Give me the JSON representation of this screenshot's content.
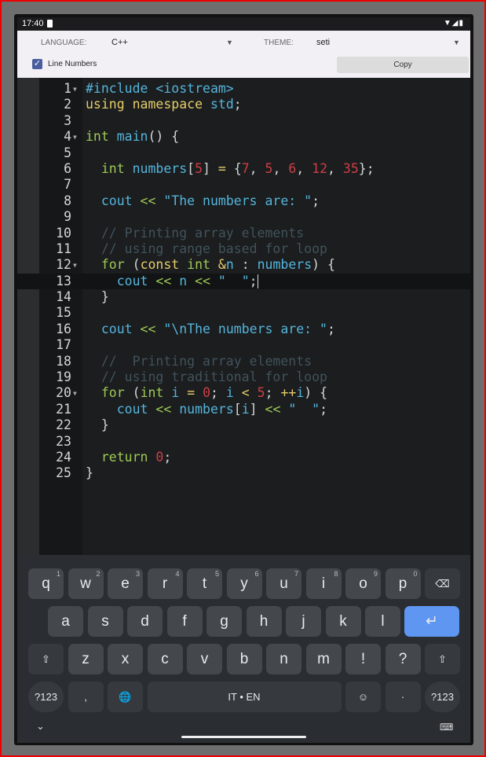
{
  "status": {
    "time": "17:40",
    "icons": "▼◢▮"
  },
  "toolbar": {
    "language_label": "LANGUAGE:",
    "language_value": "C++",
    "theme_label": "THEME:",
    "theme_value": "seti",
    "line_numbers_label": "Line Numbers",
    "line_numbers_checked": true,
    "copy_label": "Copy"
  },
  "colors": {
    "blue": "#55b5db",
    "yellow": "#e6cd69",
    "green": "#9fca56",
    "red": "#cd3f45",
    "comment": "#41535b",
    "enter": "#5e96f2"
  },
  "code": [
    {
      "n": "1",
      "fold": true,
      "t": [
        [
          "blue",
          "#include <iostream>"
        ]
      ]
    },
    {
      "n": "2",
      "t": [
        [
          "yellow",
          "using namespace "
        ],
        [
          "blue",
          "std"
        ],
        [
          "plain",
          ";"
        ]
      ]
    },
    {
      "n": "3",
      "t": []
    },
    {
      "n": "4",
      "fold": true,
      "t": [
        [
          "green",
          "int "
        ],
        [
          "blue",
          "main"
        ],
        [
          "plain",
          "() {"
        ]
      ]
    },
    {
      "n": "5",
      "t": []
    },
    {
      "n": "6",
      "t": [
        [
          "plain",
          "  "
        ],
        [
          "green",
          "int "
        ],
        [
          "blue",
          "numbers"
        ],
        [
          "plain",
          "["
        ],
        [
          "red",
          "5"
        ],
        [
          "plain",
          "] "
        ],
        [
          "yellow",
          "="
        ],
        [
          "plain",
          " {"
        ],
        [
          "red",
          "7"
        ],
        [
          "plain",
          ", "
        ],
        [
          "red",
          "5"
        ],
        [
          "plain",
          ", "
        ],
        [
          "red",
          "6"
        ],
        [
          "plain",
          ", "
        ],
        [
          "red",
          "12"
        ],
        [
          "plain",
          ", "
        ],
        [
          "red",
          "35"
        ],
        [
          "plain",
          "};"
        ]
      ]
    },
    {
      "n": "7",
      "t": []
    },
    {
      "n": "8",
      "t": [
        [
          "plain",
          "  "
        ],
        [
          "blue",
          "cout "
        ],
        [
          "green",
          "<< "
        ],
        [
          "blue",
          "\"The numbers are: \""
        ],
        [
          "plain",
          ";"
        ]
      ]
    },
    {
      "n": "9",
      "t": []
    },
    {
      "n": "10",
      "t": [
        [
          "comment",
          "  // Printing array elements"
        ]
      ]
    },
    {
      "n": "11",
      "t": [
        [
          "comment",
          "  // using range based for loop"
        ]
      ]
    },
    {
      "n": "12",
      "fold": true,
      "t": [
        [
          "plain",
          "  "
        ],
        [
          "green",
          "for "
        ],
        [
          "plain",
          "("
        ],
        [
          "yellow",
          "const "
        ],
        [
          "green",
          "int "
        ],
        [
          "yellow",
          "&"
        ],
        [
          "blue",
          "n "
        ],
        [
          "plain",
          ": "
        ],
        [
          "blue",
          "numbers"
        ],
        [
          "plain",
          ") {"
        ]
      ]
    },
    {
      "n": "13",
      "active": true,
      "cursor": true,
      "t": [
        [
          "plain",
          "    "
        ],
        [
          "blue",
          "cout "
        ],
        [
          "green",
          "<< "
        ],
        [
          "blue",
          "n "
        ],
        [
          "green",
          "<< "
        ],
        [
          "blue",
          "\"  \""
        ],
        [
          "plain",
          ";"
        ]
      ]
    },
    {
      "n": "14",
      "t": [
        [
          "plain",
          "  }"
        ]
      ]
    },
    {
      "n": "15",
      "t": []
    },
    {
      "n": "16",
      "t": [
        [
          "plain",
          "  "
        ],
        [
          "blue",
          "cout "
        ],
        [
          "green",
          "<< "
        ],
        [
          "blue",
          "\"\\nThe numbers are: \""
        ],
        [
          "plain",
          ";"
        ]
      ]
    },
    {
      "n": "17",
      "t": []
    },
    {
      "n": "18",
      "t": [
        [
          "comment",
          "  //  Printing array elements"
        ]
      ]
    },
    {
      "n": "19",
      "t": [
        [
          "comment",
          "  // using traditional for loop"
        ]
      ]
    },
    {
      "n": "20",
      "fold": true,
      "t": [
        [
          "plain",
          "  "
        ],
        [
          "green",
          "for "
        ],
        [
          "plain",
          "("
        ],
        [
          "green",
          "int "
        ],
        [
          "blue",
          "i "
        ],
        [
          "yellow",
          "= "
        ],
        [
          "red",
          "0"
        ],
        [
          "plain",
          "; "
        ],
        [
          "blue",
          "i "
        ],
        [
          "yellow",
          "< "
        ],
        [
          "red",
          "5"
        ],
        [
          "plain",
          "; "
        ],
        [
          "yellow",
          "++"
        ],
        [
          "blue",
          "i"
        ],
        [
          "plain",
          ") {"
        ]
      ]
    },
    {
      "n": "21",
      "t": [
        [
          "plain",
          "    "
        ],
        [
          "blue",
          "cout "
        ],
        [
          "green",
          "<< "
        ],
        [
          "blue",
          "numbers"
        ],
        [
          "plain",
          "["
        ],
        [
          "blue",
          "i"
        ],
        [
          "plain",
          "] "
        ],
        [
          "green",
          "<< "
        ],
        [
          "blue",
          "\"  \""
        ],
        [
          "plain",
          ";"
        ]
      ]
    },
    {
      "n": "22",
      "t": [
        [
          "plain",
          "  }"
        ]
      ]
    },
    {
      "n": "23",
      "t": []
    },
    {
      "n": "24",
      "t": [
        [
          "plain",
          "  "
        ],
        [
          "green",
          "return "
        ],
        [
          "red",
          "0"
        ],
        [
          "plain",
          ";"
        ]
      ]
    },
    {
      "n": "25",
      "t": [
        [
          "plain",
          "}"
        ]
      ]
    }
  ],
  "keyboard": {
    "row1": [
      [
        "q",
        "1"
      ],
      [
        "w",
        "2"
      ],
      [
        "e",
        "3"
      ],
      [
        "r",
        "4"
      ],
      [
        "t",
        "5"
      ],
      [
        "y",
        "6"
      ],
      [
        "u",
        "7"
      ],
      [
        "i",
        "8"
      ],
      [
        "o",
        "9"
      ],
      [
        "p",
        "0"
      ]
    ],
    "backspace": "⌫",
    "row2": [
      "a",
      "s",
      "d",
      "f",
      "g",
      "h",
      "j",
      "k",
      "l"
    ],
    "enter": "↵",
    "shift": "⇧",
    "row3": [
      "z",
      "x",
      "c",
      "v",
      "b",
      "n",
      "m",
      "!",
      "?"
    ],
    "symbols": "?123",
    "comma": ",",
    "globe": "🌐",
    "space": "IT • EN",
    "emoji": "☺",
    "period": "·",
    "hide": "⌄",
    "keyboard_switch": "⌨"
  }
}
